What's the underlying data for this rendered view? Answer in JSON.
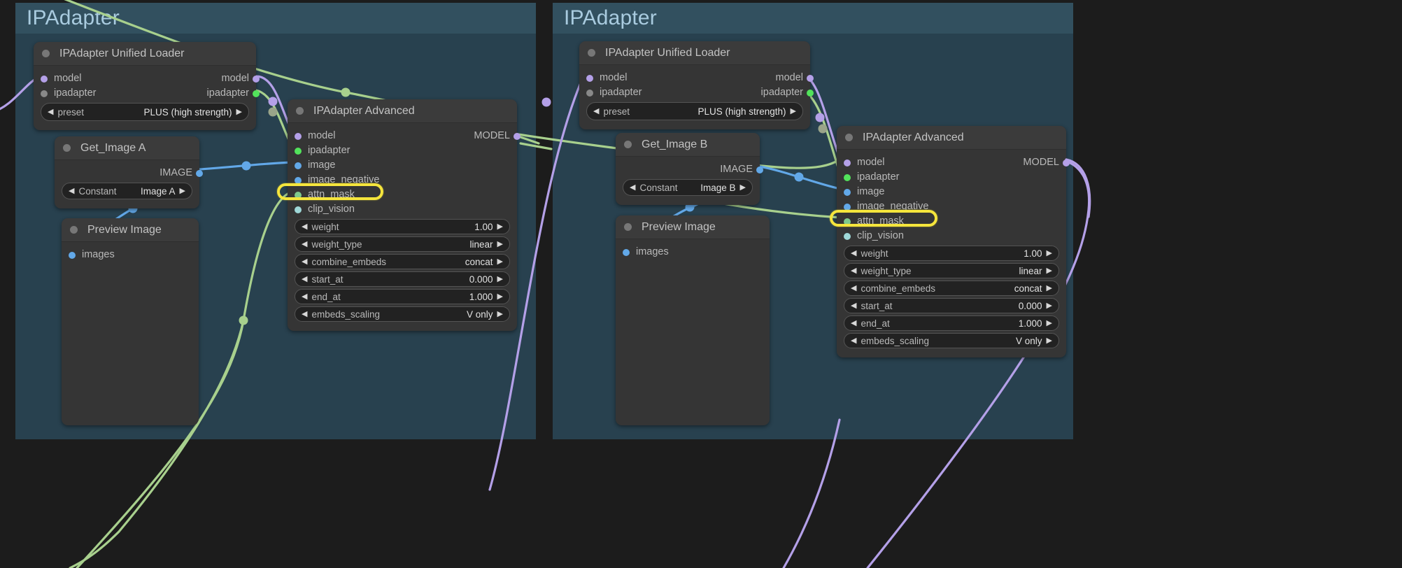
{
  "app": {
    "canvas_background": "#1c1c1c",
    "highlight_color": "#f5e53c"
  },
  "groups": [
    {
      "title": "IPAdapter",
      "color": "#32505f"
    },
    {
      "title": "IPAdapter",
      "color": "#32505f"
    }
  ],
  "left_panel": {
    "group_title": "IPAdapter",
    "nodes": {
      "unified_loader": {
        "title": "IPAdapter Unified Loader",
        "inputs": [
          {
            "label": "model",
            "color": "#b4a0e8"
          },
          {
            "label": "ipadapter",
            "color": "#888888"
          }
        ],
        "outputs": [
          {
            "label": "model",
            "color": "#b4a0e8"
          },
          {
            "label": "ipadapter",
            "color": "#52e35b"
          }
        ],
        "widgets": [
          {
            "name": "preset",
            "value": "PLUS (high strength)"
          }
        ]
      },
      "get_image": {
        "title": "Get_Image A",
        "outputs": [
          {
            "label": "IMAGE",
            "color": "#62a8e8"
          }
        ],
        "widgets": [
          {
            "name": "Constant",
            "value": "Image A"
          }
        ]
      },
      "preview_image": {
        "title": "Preview Image",
        "inputs": [
          {
            "label": "images",
            "color": "#62a8e8"
          }
        ]
      },
      "ipadapter_advanced": {
        "title": "IPAdapter Advanced",
        "inputs": [
          {
            "label": "model",
            "color": "#b4a0e8"
          },
          {
            "label": "ipadapter",
            "color": "#52e35b"
          },
          {
            "label": "image",
            "color": "#62a8e8"
          },
          {
            "label": "image_negative",
            "color": "#62a8e8"
          },
          {
            "label": "attn_mask",
            "color": "#7fc98c"
          },
          {
            "label": "clip_vision",
            "color": "#9fd8d8"
          }
        ],
        "outputs": [
          {
            "label": "MODEL",
            "color": "#b4a0e8"
          }
        ],
        "widgets": [
          {
            "name": "weight",
            "value": "1.00"
          },
          {
            "name": "weight_type",
            "value": "linear"
          },
          {
            "name": "combine_embeds",
            "value": "concat"
          },
          {
            "name": "start_at",
            "value": "0.000"
          },
          {
            "name": "end_at",
            "value": "1.000"
          },
          {
            "name": "embeds_scaling",
            "value": "V only"
          }
        ],
        "highlighted_input": "attn_mask"
      }
    }
  },
  "right_panel": {
    "group_title": "IPAdapter",
    "nodes": {
      "unified_loader": {
        "title": "IPAdapter Unified Loader",
        "inputs": [
          {
            "label": "model",
            "color": "#b4a0e8"
          },
          {
            "label": "ipadapter",
            "color": "#888888"
          }
        ],
        "outputs": [
          {
            "label": "model",
            "color": "#b4a0e8"
          },
          {
            "label": "ipadapter",
            "color": "#52e35b"
          }
        ],
        "widgets": [
          {
            "name": "preset",
            "value": "PLUS (high strength)"
          }
        ]
      },
      "get_image": {
        "title": "Get_Image B",
        "outputs": [
          {
            "label": "IMAGE",
            "color": "#62a8e8"
          }
        ],
        "widgets": [
          {
            "name": "Constant",
            "value": "Image B"
          }
        ]
      },
      "preview_image": {
        "title": "Preview Image",
        "inputs": [
          {
            "label": "images",
            "color": "#62a8e8"
          }
        ]
      },
      "ipadapter_advanced": {
        "title": "IPAdapter Advanced",
        "inputs": [
          {
            "label": "model",
            "color": "#b4a0e8"
          },
          {
            "label": "ipadapter",
            "color": "#52e35b"
          },
          {
            "label": "image",
            "color": "#62a8e8"
          },
          {
            "label": "image_negative",
            "color": "#62a8e8"
          },
          {
            "label": "attn_mask",
            "color": "#7fc98c"
          },
          {
            "label": "clip_vision",
            "color": "#9fd8d8"
          }
        ],
        "outputs": [
          {
            "label": "MODEL",
            "color": "#b4a0e8"
          }
        ],
        "widgets": [
          {
            "name": "weight",
            "value": "1.00"
          },
          {
            "name": "weight_type",
            "value": "linear"
          },
          {
            "name": "combine_embeds",
            "value": "concat"
          },
          {
            "name": "start_at",
            "value": "0.000"
          },
          {
            "name": "end_at",
            "value": "1.000"
          },
          {
            "name": "embeds_scaling",
            "value": "V only"
          }
        ],
        "highlighted_input": "attn_mask"
      }
    }
  },
  "link_colors": {
    "model": "#b4a0e8",
    "ipadapter": "#a8d08d",
    "image": "#62a8e8",
    "mask": "#a8d08d"
  }
}
